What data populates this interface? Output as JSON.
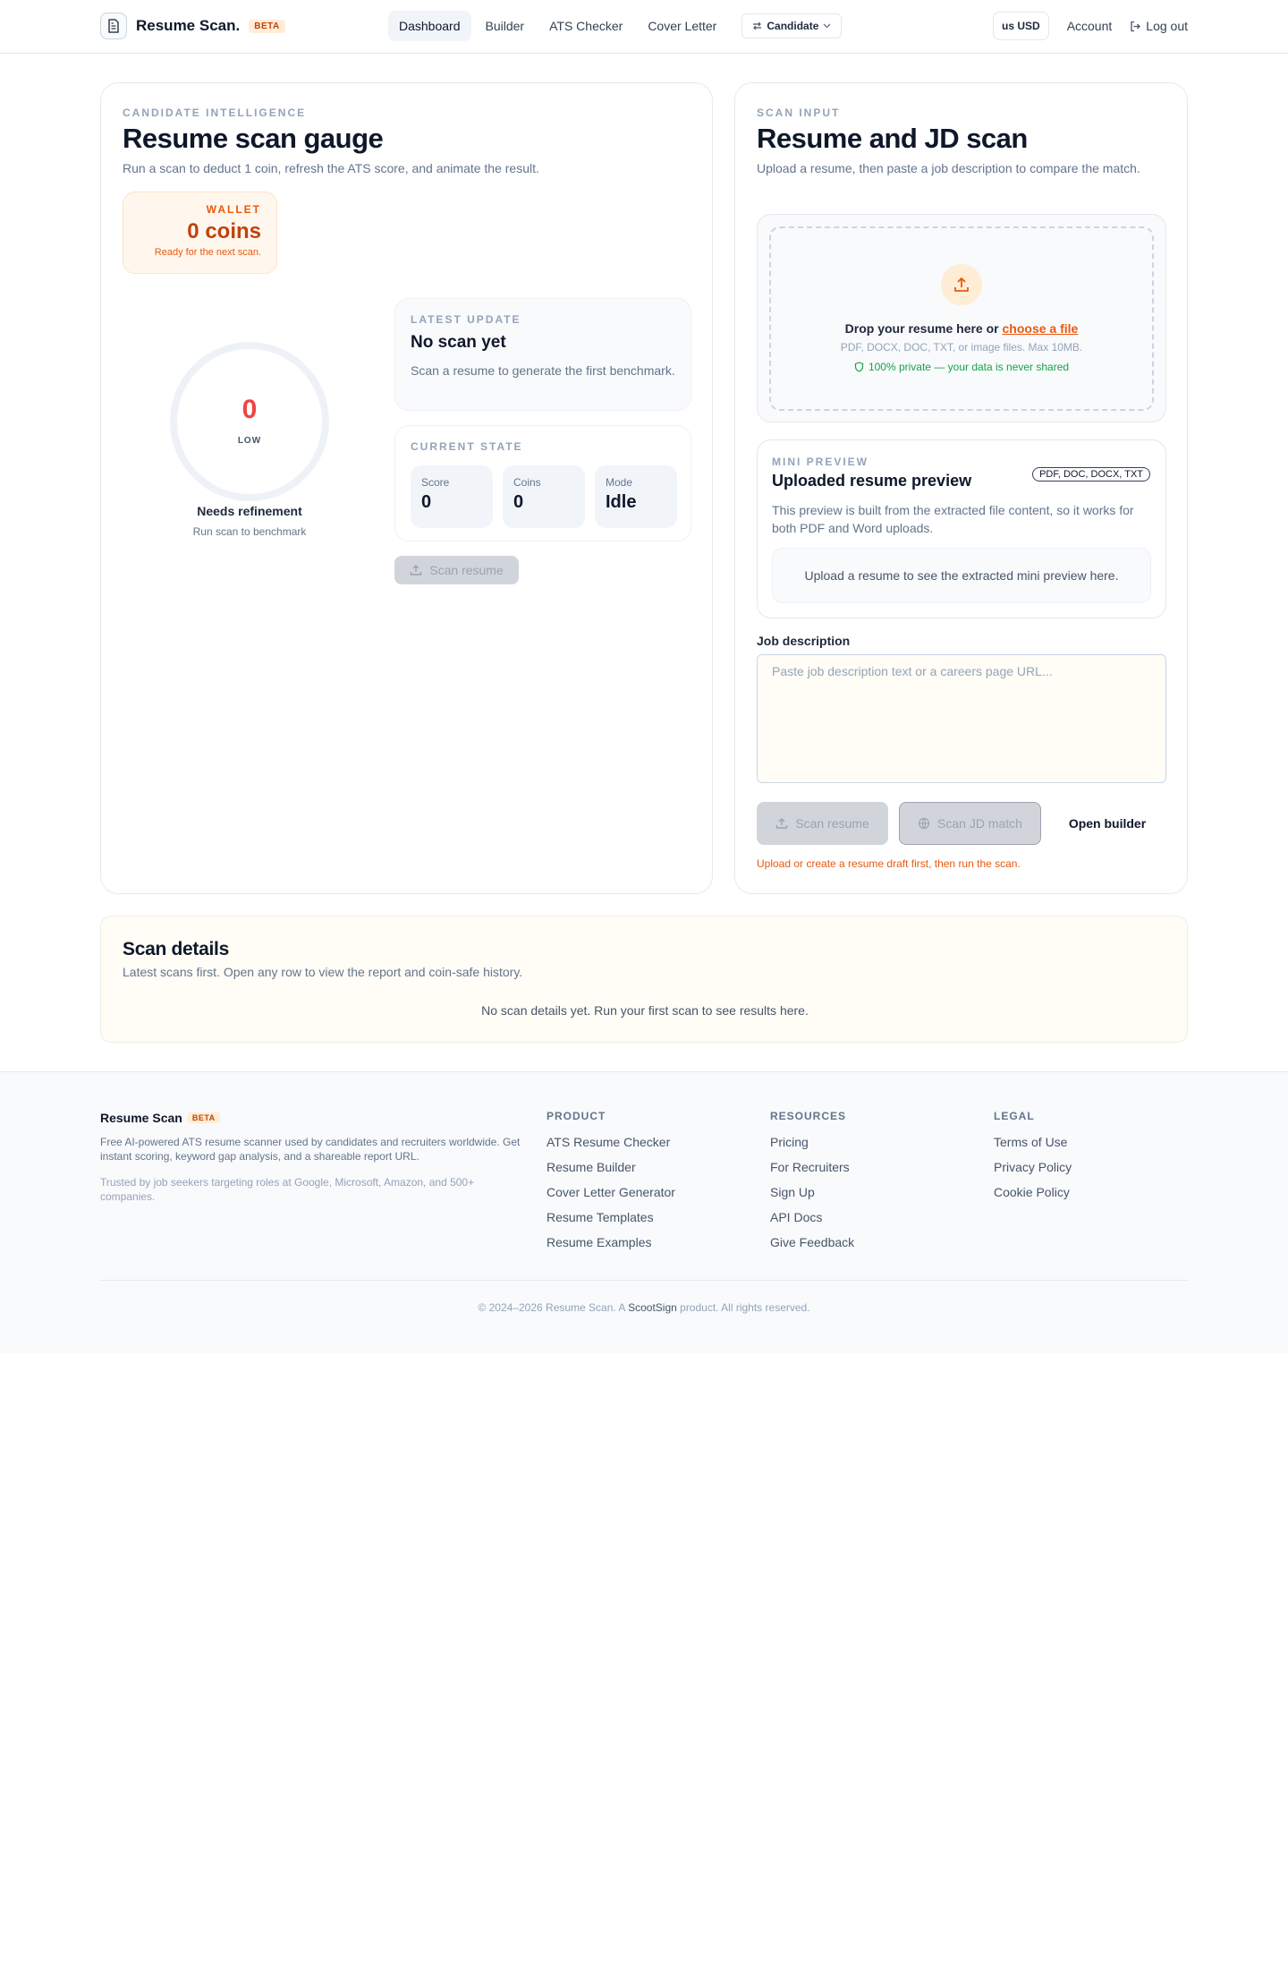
{
  "header": {
    "brand": "Resume Scan.",
    "beta": "BETA",
    "nav": [
      "Dashboard",
      "Builder",
      "ATS Checker",
      "Cover Letter"
    ],
    "role_select": "Candidate",
    "currency": "us USD",
    "account": "Account",
    "logout": "Log out"
  },
  "gauge_card": {
    "eyebrow": "CANDIDATE INTELLIGENCE",
    "title": "Resume scan gauge",
    "subtitle": "Run a scan to deduct 1 coin, refresh the ATS score, and animate the result.",
    "wallet": {
      "label": "WALLET",
      "coins": "0 coins",
      "note": "Ready for the next scan."
    },
    "gauge": {
      "score": "0",
      "level": "LOW",
      "status": "Needs refinement",
      "hint": "Run scan to benchmark",
      "fill_fraction": 0
    },
    "latest_update": {
      "label": "LATEST UPDATE",
      "title": "No scan yet",
      "body": "Scan a resume to generate the first benchmark."
    },
    "current_state": {
      "label": "CURRENT STATE",
      "stats": [
        {
          "label": "Score",
          "value": "0"
        },
        {
          "label": "Coins",
          "value": "0"
        },
        {
          "label": "Mode",
          "value": "Idle"
        }
      ]
    },
    "scan_button": "Scan resume"
  },
  "scan_card": {
    "eyebrow": "SCAN INPUT",
    "title": "Resume and JD scan",
    "subtitle": "Upload a resume, then paste a job description to compare the match.",
    "dropzone": {
      "text": "Drop your resume here or",
      "link": "choose a file",
      "formats": "PDF, DOCX, DOC, TXT, or image files. Max 10MB.",
      "privacy": "100% private — your data is never shared"
    },
    "mini_preview": {
      "label": "MINI PREVIEW",
      "title": "Uploaded resume preview",
      "badge": "PDF, DOC, DOCX, TXT",
      "body": "This preview is built from the extracted file content, so it works for both PDF and Word uploads.",
      "empty": "Upload a resume to see the extracted mini preview here."
    },
    "jd": {
      "label": "Job description",
      "placeholder": "Paste job description text or a careers page URL...",
      "value": ""
    },
    "buttons": {
      "scan_resume": "Scan resume",
      "scan_jd": "Scan JD match",
      "open_builder": "Open builder"
    },
    "warning": "Upload or create a resume draft first, then run the scan."
  },
  "scan_details": {
    "title": "Scan details",
    "subtitle": "Latest scans first. Open any row to view the report and coin-safe history.",
    "empty": "No scan details yet. Run your first scan to see results here."
  },
  "footer": {
    "brand": "Resume Scan",
    "beta": "BETA",
    "description": "Free AI-powered ATS resume scanner used by candidates and recruiters worldwide. Get instant scoring, keyword gap analysis, and a shareable report URL.",
    "trust": "Trusted by job seekers targeting roles at Google, Microsoft, Amazon, and 500+ companies.",
    "columns": [
      {
        "title": "PRODUCT",
        "links": [
          "ATS Resume Checker",
          "Resume Builder",
          "Cover Letter Generator",
          "Resume Templates",
          "Resume Examples"
        ]
      },
      {
        "title": "RESOURCES",
        "links": [
          "Pricing",
          "For Recruiters",
          "Sign Up",
          "API Docs",
          "Give Feedback"
        ]
      },
      {
        "title": "LEGAL",
        "links": [
          "Terms of Use",
          "Privacy Policy",
          "Cookie Policy"
        ]
      }
    ],
    "copyright_prefix": "© 2024–2026 Resume Scan. A",
    "copyright_brand": "ScootSign",
    "copyright_suffix": "product. All rights reserved."
  },
  "colors": {
    "accent": "#ea580c",
    "score_low": "#ef4444",
    "success": "#16a34a"
  }
}
